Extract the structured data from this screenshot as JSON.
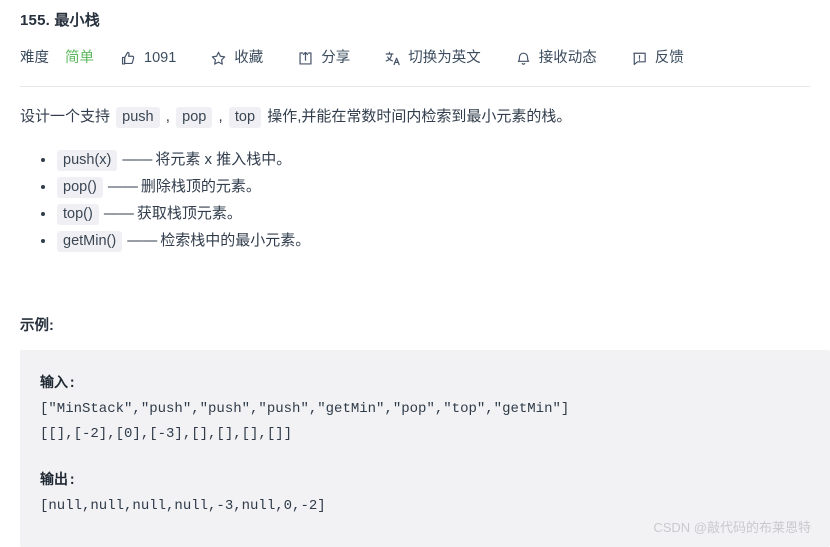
{
  "header": {
    "title": "155. 最小栈"
  },
  "toolbar": {
    "difficulty_label": "难度",
    "difficulty_value": "简单",
    "like_count": "1091",
    "favorite_label": "收藏",
    "share_label": "分享",
    "translate_label": "切换为英文",
    "subscribe_label": "接收动态",
    "feedback_label": "反馈",
    "icons": {
      "like": "thumbs-up-icon",
      "favorite": "star-icon",
      "share": "share-icon",
      "translate": "translate-icon",
      "subscribe": "bell-icon",
      "feedback": "feedback-icon"
    }
  },
  "description": {
    "part1": "设计一个支持 ",
    "code1": "push",
    "sep1": " , ",
    "code2": "pop",
    "sep2": " , ",
    "code3": "top",
    "part2": " 操作,并能在常数时间内检索到最小元素的栈。"
  },
  "operations": [
    {
      "code": "push(x)",
      "dash": "——",
      "text": "将元素 x 推入栈中。"
    },
    {
      "code": "pop()",
      "dash": "——",
      "text": "删除栈顶的元素。"
    },
    {
      "code": "top()",
      "dash": "——",
      "text": "获取栈顶元素。"
    },
    {
      "code": "getMin()",
      "dash": "——",
      "text": "检索栈中的最小元素。"
    }
  ],
  "example": {
    "heading": "示例:",
    "input_label": "输入:",
    "input_line1": "[\"MinStack\",\"push\",\"push\",\"push\",\"getMin\",\"pop\",\"top\",\"getMin\"]",
    "input_line2": "[[],[-2],[0],[-3],[],[],[],[]]",
    "output_label": "输出:",
    "output_line1": "[null,null,null,null,-3,null,0,-2]"
  },
  "watermark": {
    "text": "CSDN @敲代码的布莱恩特"
  },
  "colors": {
    "difficulty_easy": "#5db85c",
    "code_background": "#f2f2f4",
    "inline_code_background": "#f0f0f4",
    "text": "#313d4c",
    "divider": "#e8e8ec",
    "watermark": "#c9cace"
  }
}
